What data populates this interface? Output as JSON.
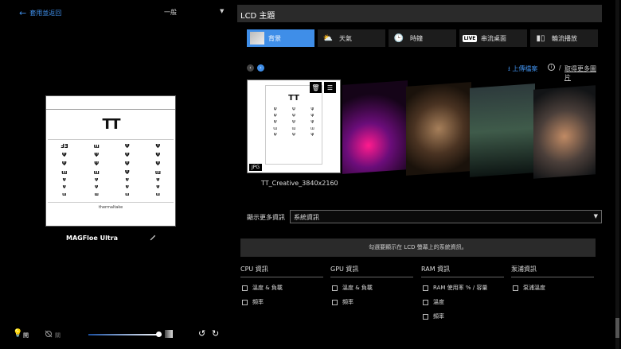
{
  "left": {
    "back_label": "套用並返回",
    "mode": "一般",
    "preview": {
      "logo": "TT",
      "footer": "thermaltake"
    },
    "device_name": "MAGFloe Ultra",
    "light_label": "開",
    "fan_label": "關",
    "brightness": 0.97
  },
  "right": {
    "title": "LCD 主題",
    "tabs": [
      {
        "label": "背景",
        "icon": "image-icon",
        "active": true
      },
      {
        "label": "天氣",
        "icon": "weather-icon",
        "active": false
      },
      {
        "label": "時鐘",
        "icon": "clock-icon",
        "active": false
      },
      {
        "label": "串流桌面",
        "icon": "live-icon",
        "active": false
      },
      {
        "label": "輪流播放",
        "icon": "slideshow-icon",
        "active": false
      }
    ],
    "upload_label": "上傳檔案",
    "slash": "/",
    "more_images_label": "取得更多圖片",
    "selected_thumb": {
      "logo": "TT",
      "format": "JPG",
      "caption": "TT_Creative_3840x2160"
    },
    "more_info_label": "顯示更多資訊",
    "select_value": "系統資訊",
    "hint": "勾選要顯示在 LCD 螢幕上的系統資訊。",
    "groups": [
      {
        "head": "CPU 資訊",
        "items": [
          "溫度 & 負載",
          "頻率"
        ]
      },
      {
        "head": "GPU 資訊",
        "items": [
          "溫度 & 負載",
          "頻率"
        ]
      },
      {
        "head": "RAM 資訊",
        "items": [
          "RAM 使用率 % / 容量",
          "溫度",
          "頻率"
        ]
      },
      {
        "head": "泵浦資訊",
        "items": [
          "泵浦溫度"
        ]
      }
    ]
  },
  "colors": {
    "accent": "#3f8ee8",
    "panel": "#2a2a2a"
  }
}
